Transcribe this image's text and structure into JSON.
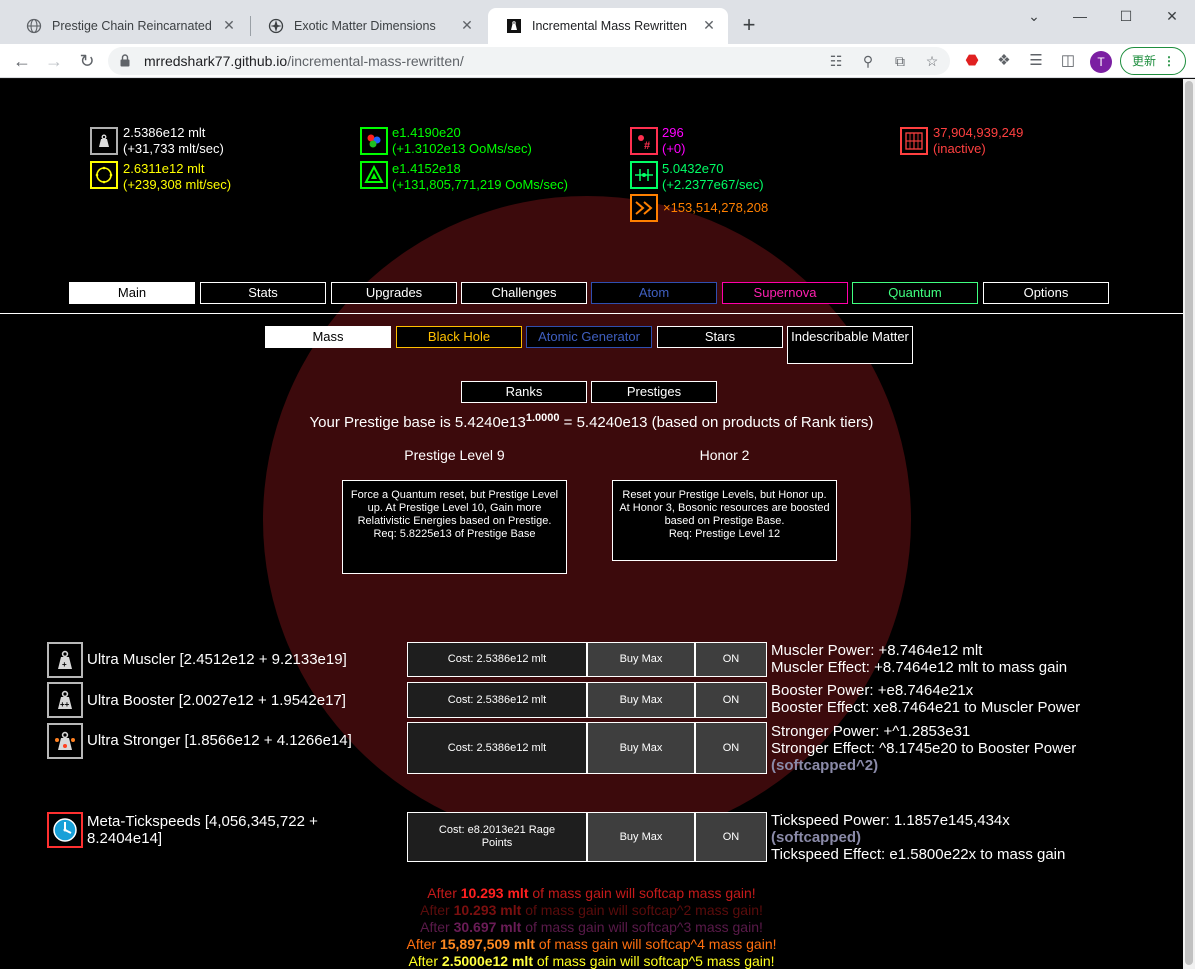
{
  "browser": {
    "tabs": [
      {
        "title": "Prestige Chain Reincarnated",
        "close": "✕"
      },
      {
        "title": "Exotic Matter Dimensions",
        "close": "✕"
      },
      {
        "title": "Incremental Mass Rewritten",
        "close": "✕"
      }
    ],
    "new_tab": "+",
    "window_controls": {
      "minimize": "—",
      "maximize": "☐",
      "close": "✕",
      "menu": "⌄"
    },
    "url_host": "mrredshark77.github.io",
    "url_path": "/incremental-mass-rewritten/",
    "profile_initial": "T",
    "update_label": "更新",
    "update_menu": "⋮"
  },
  "resources": {
    "mass": {
      "value": "2.5386e12 mlt",
      "rate": "(+31,733 mlt/sec)",
      "icon": "weight-icon",
      "color": "#ffffff"
    },
    "rage": {
      "value": "2.6311e12 mlt",
      "rate": "(+239,308 mlt/sec)",
      "icon": "black-hole-icon",
      "color": "#ffff00"
    },
    "quarks": {
      "value": "e1.4190e20",
      "rate": "(+1.3102e13 OoMs/sec)",
      "icon": "quarks-icon",
      "color": "#00ff00"
    },
    "stardust": {
      "value": "e1.4152e18",
      "rate": "(+131,805,771,219 OoMs/sec)",
      "icon": "supernova-triangle-icon",
      "color": "#00ff00"
    },
    "supernova": {
      "value": "296",
      "rate": "(+0)",
      "icon": "supernova-count-icon",
      "color": "#ff00ff"
    },
    "quantum": {
      "value": "5.0432e70",
      "rate": "(+2.2377e67/sec)",
      "icon": "quantum-foam-icon",
      "color": "#00ff66"
    },
    "speed": {
      "value": "×153,514,278,208",
      "icon": "speed-arrows-icon",
      "color": "#ff8000"
    },
    "inactive": {
      "value": "37,904,939,249",
      "rate": "(inactive)",
      "icon": "grid-icon",
      "color": "#ff4040"
    }
  },
  "main_tabs": [
    "Main",
    "Stats",
    "Upgrades",
    "Challenges",
    "Atom",
    "Supernova",
    "Quantum",
    "Options"
  ],
  "sub_tabs": [
    "Mass",
    "Black Hole",
    "Atomic Generator",
    "Stars",
    "Indescribable Matter"
  ],
  "prestige_tabs": [
    "Ranks",
    "Prestiges"
  ],
  "prestige_base": {
    "prefix": "Your Prestige base is 5.4240e13",
    "exponent": "1.0000",
    "suffix": " = 5.4240e13 (based on products of Rank tiers)"
  },
  "prestige_level": {
    "title": "Prestige Level 9",
    "desc": "Force a Quantum reset, but Prestige Level up. At Prestige Level 10, Gain more Relativistic Energies based on Prestige.",
    "req": "Req: 5.8225e13 of Prestige Base"
  },
  "honor": {
    "title": "Honor 2",
    "desc": "Reset your Prestige Levels, but Honor up. At Honor 3, Bosonic resources are boosted based on Prestige Base.",
    "req": "Req: Prestige Level 12"
  },
  "upgrades": [
    {
      "name": "Ultra Muscler [2.4512e12 + 9.2133e19]",
      "icon": "muscler-weight-icon",
      "cost": "Cost: 2.5386e12 mlt",
      "buy_max": "Buy Max",
      "toggle": "ON",
      "effects": [
        "Muscler Power: +8.7464e12 mlt",
        "Muscler Effect: +8.7464e12 mlt to mass gain"
      ],
      "tag": ""
    },
    {
      "name": "Ultra Booster [2.0027e12 + 1.9542e17]",
      "icon": "booster-weight-icon",
      "cost": "Cost: 2.5386e12 mlt",
      "buy_max": "Buy Max",
      "toggle": "ON",
      "effects": [
        "Booster Power: +e8.7464e21x",
        "Booster Effect: xe8.7464e21 to Muscler Power"
      ],
      "tag": ""
    },
    {
      "name": "Ultra Stronger [1.8566e12 + 4.1266e14]",
      "icon": "stronger-weight-icon",
      "cost": "Cost: 2.5386e12 mlt",
      "buy_max": "Buy Max",
      "toggle": "ON",
      "effects": [
        "Stronger Power: +^1.2853e31",
        "Stronger Effect: ^8.1745e20 to Booster Power"
      ],
      "tag": "(softcapped^2)"
    }
  ],
  "tickspeed": {
    "name": "Meta-Tickspeeds [4,056,345,722 + 8.2404e14]",
    "icon": "tickspeed-clock-icon",
    "cost": "Cost: e8.2013e21 Rage Points",
    "buy_max": "Buy Max",
    "toggle": "ON",
    "power": "Tickspeed Power: 1.1857e145,434x",
    "tag": "(softcapped)",
    "effect": "Tickspeed Effect: e1.5800e22x to mass gain"
  },
  "softcaps": [
    {
      "pre": "After ",
      "value": "10.293 mlt",
      "post": " of mass gain will softcap mass gain!",
      "color": "#c41a1a",
      "value_color": "#ff2020"
    },
    {
      "pre": "After ",
      "value": "10.293 mlt",
      "post": " of mass gain will softcap^2 mass gain!",
      "color": "#5a0c0c",
      "value_color": "#7a0f0f"
    },
    {
      "pre": "After ",
      "value": "30.697 mlt",
      "post": " of mass gain will softcap^3 mass gain!",
      "color": "#5a1a4a",
      "value_color": "#6a1c56"
    },
    {
      "pre": "After ",
      "value": "15,897,509 mlt",
      "post": " of mass gain will softcap^4 mass gain!",
      "color": "#ff7010",
      "value_color": "#ff8a20"
    },
    {
      "pre": "After ",
      "value": "2.5000e12 mlt",
      "post": " of mass gain will softcap^5 mass gain!",
      "color": "#ffff20",
      "value_color": "#ffff40"
    }
  ]
}
